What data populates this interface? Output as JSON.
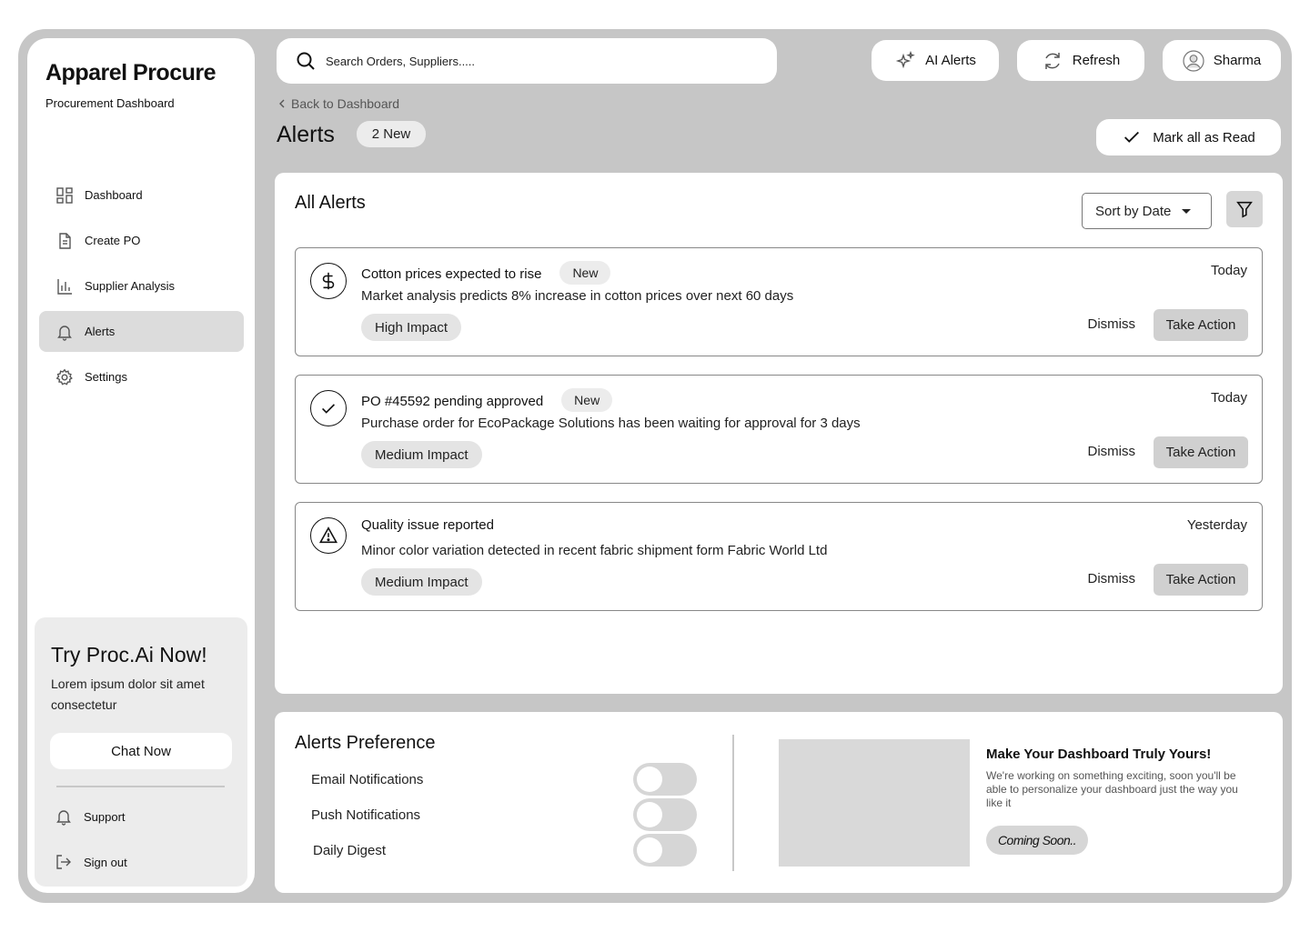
{
  "brand": {
    "name": "Apparel Procure",
    "subtitle": "Procurement Dashboard"
  },
  "sidebar": {
    "items": [
      {
        "label": "Dashboard",
        "icon": "dashboard-icon"
      },
      {
        "label": "Create PO",
        "icon": "document-icon"
      },
      {
        "label": "Supplier Analysis",
        "icon": "bar-chart-icon"
      },
      {
        "label": "Alerts",
        "icon": "bell-icon",
        "active": true
      },
      {
        "label": "Settings",
        "icon": "gear-icon"
      }
    ],
    "promo": {
      "title": "Try Proc.Ai Now!",
      "text": "Lorem ipsum dolor sit amet consectetur",
      "button": "Chat Now"
    },
    "bottom": [
      {
        "label": "Support",
        "icon": "bell-icon"
      },
      {
        "label": "Sign out",
        "icon": "sign-out-icon"
      }
    ]
  },
  "search": {
    "placeholder": "Search Orders, Suppliers....."
  },
  "topbar": {
    "ai_alerts": "AI Alerts",
    "refresh": "Refresh",
    "user": "Sharma"
  },
  "header": {
    "back": "Back to Dashboard",
    "title": "Alerts",
    "new_count": "2 New",
    "mark_read": "Mark all as Read"
  },
  "alerts_panel": {
    "title": "All Alerts",
    "sort": "Sort by Date",
    "dismiss_label": "Dismiss",
    "action_label": "Take Action",
    "items": [
      {
        "icon": "dollar-icon",
        "title": "Cotton prices expected to rise",
        "badge": "New",
        "description": "Market analysis predicts 8% increase in cotton prices over next 60 days",
        "impact": "High Impact",
        "time": "Today"
      },
      {
        "icon": "check-icon",
        "title": "PO #45592 pending approved",
        "badge": "New",
        "description": "Purchase order for EcoPackage Solutions has been waiting for approval for 3 days",
        "impact": "Medium Impact",
        "time": "Today"
      },
      {
        "icon": "warning-icon",
        "title": "Quality issue reported",
        "badge": "",
        "description": "Minor color variation detected in recent fabric shipment form Fabric World Ltd",
        "impact": "Medium Impact",
        "time": "Yesterday"
      }
    ]
  },
  "preferences": {
    "title": "Alerts Preference",
    "items": [
      {
        "label": "Email Notifications",
        "enabled": false
      },
      {
        "label": "Push Notifications",
        "enabled": false
      },
      {
        "label": "Daily Digest",
        "enabled": false
      }
    ],
    "promo": {
      "title": "Make Your Dashboard Truly Yours!",
      "text": "We're working on something exciting, soon you'll be able to personalize your dashboard just the way you like it",
      "badge": "Coming Soon.."
    }
  }
}
